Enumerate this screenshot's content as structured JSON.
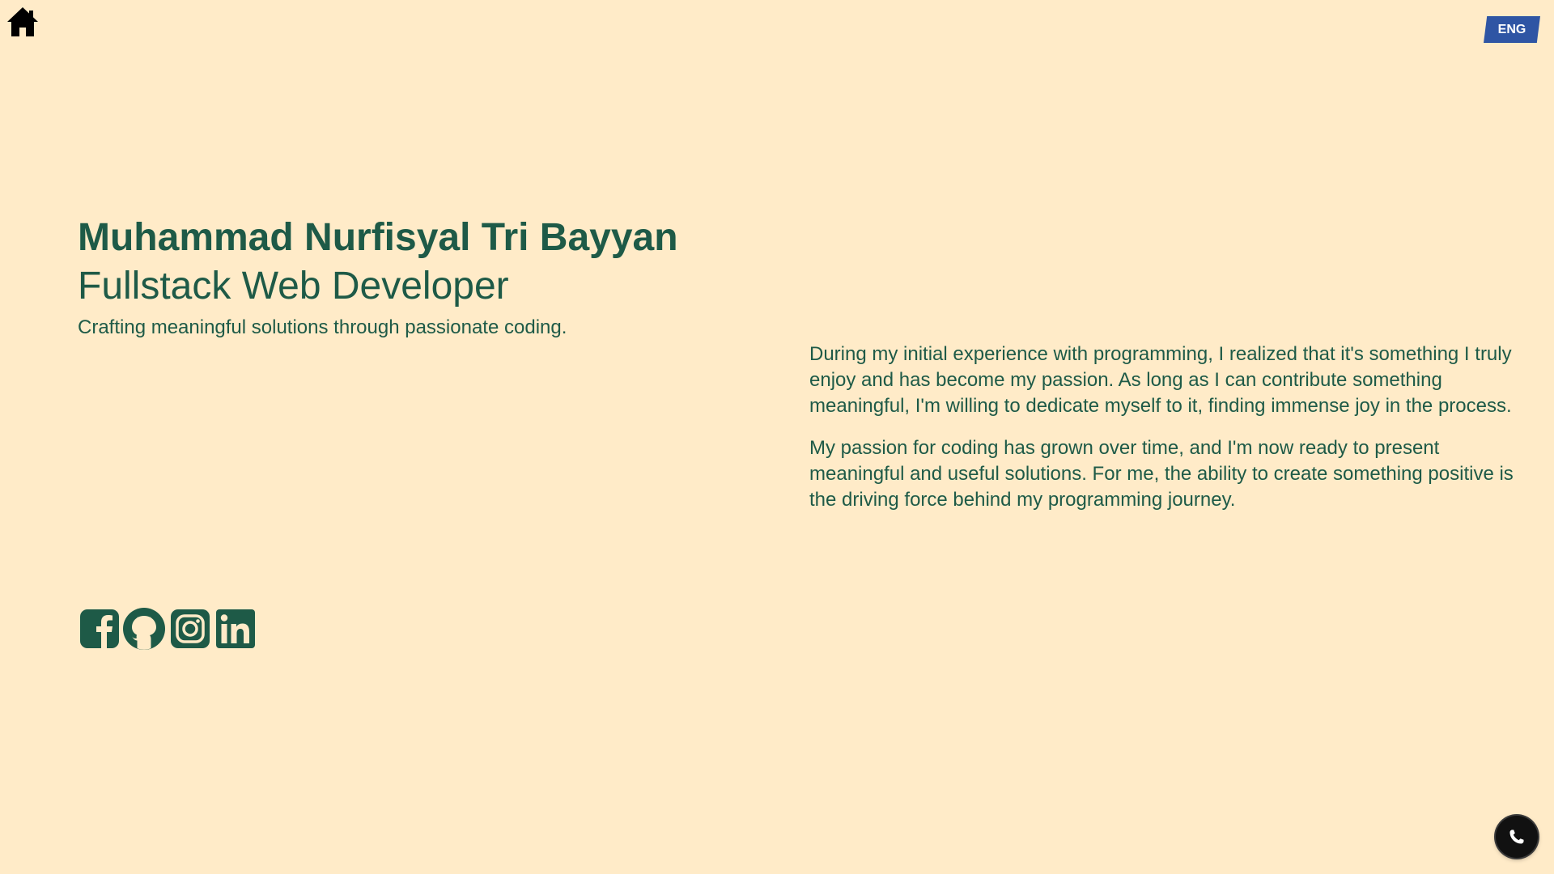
{
  "nav": {
    "home_icon": "home-icon",
    "language_label": "ENG",
    "accent_color": "#2f55a4"
  },
  "hero": {
    "name": "Muhammad Nurfisyal Tri Bayyan",
    "role": "Fullstack Web Developer",
    "tagline": "Crafting meaningful solutions through passionate coding."
  },
  "about": {
    "paragraphs": [
      "During my initial experience with programming, I realized that it's something I truly enjoy and has become my passion. As long as I can contribute something meaningful, I'm willing to dedicate myself to it, finding immense joy in the process.",
      "My passion for coding has grown over time, and I'm now ready to present meaningful and useful solutions. For me, the ability to create something positive is the driving force behind my programming journey."
    ]
  },
  "socials": {
    "items": [
      {
        "icon": "facebook-icon"
      },
      {
        "icon": "github-icon"
      },
      {
        "icon": "instagram-icon"
      },
      {
        "icon": "linkedin-icon"
      }
    ]
  },
  "contact": {
    "icon": "phone-icon"
  },
  "theme": {
    "background": "#ffebc8",
    "text": "#1e5a47"
  }
}
